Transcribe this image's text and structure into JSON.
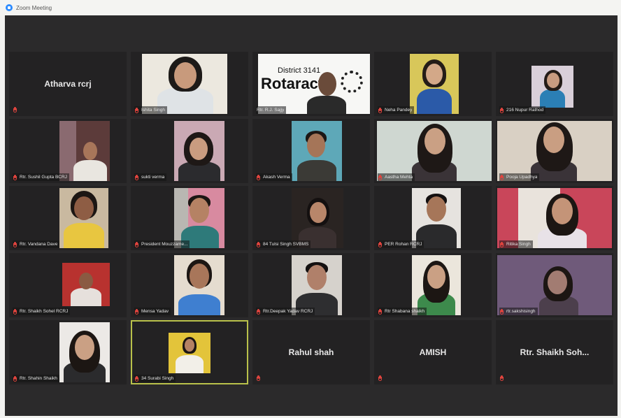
{
  "window": {
    "title": "Zoom Meeting"
  },
  "participants": [
    {
      "name": "Atharva rcrj",
      "video": false,
      "muted": true
    },
    {
      "name": "Ishita Singh",
      "video": true,
      "muted": true
    },
    {
      "name": "Rtr. R.J. Sajjy",
      "video": true,
      "muted": false,
      "overlay": {
        "line1": "District 3141",
        "line2": "Rotaract"
      }
    },
    {
      "name": "Neha Pandey",
      "video": true,
      "muted": true
    },
    {
      "name": "216 Nupur Rathod",
      "video": true,
      "muted": true
    },
    {
      "name": "Rtr. Sushil Gupta BCRJ",
      "video": true,
      "muted": true
    },
    {
      "name": "sukti verma",
      "video": true,
      "muted": true
    },
    {
      "name": "Akash Verma",
      "video": true,
      "muted": true
    },
    {
      "name": "Aastha Mehta",
      "video": true,
      "muted": true
    },
    {
      "name": "Pooja Upadhya",
      "video": true,
      "muted": true
    },
    {
      "name": "Rtr. Vandana Dave",
      "video": true,
      "muted": true
    },
    {
      "name": "President Mouzzame...",
      "video": true,
      "muted": true
    },
    {
      "name": "84 Tulsi Singh SVBMS",
      "video": true,
      "muted": true
    },
    {
      "name": "PER Rohan RCRJ",
      "video": true,
      "muted": true
    },
    {
      "name": "Ritika Singh",
      "video": true,
      "muted": true
    },
    {
      "name": "Rtr. Shaikh Sohel RCRJ",
      "video": true,
      "muted": true
    },
    {
      "name": "Mensa Yadav",
      "video": true,
      "muted": true
    },
    {
      "name": "Rtr.Deepak Yadav RCRJ",
      "video": true,
      "muted": true
    },
    {
      "name": "Rtr Shabana shaikh",
      "video": true,
      "muted": true
    },
    {
      "name": "rtr.sakshisingh",
      "video": true,
      "muted": true
    },
    {
      "name": "Rtr. Shahin Shaikh",
      "video": true,
      "muted": true
    },
    {
      "name": "34 Surabi Singh",
      "video": true,
      "muted": true,
      "active": true
    },
    {
      "name": "Rahul shah",
      "video": false,
      "muted": true
    },
    {
      "name": "AMISH",
      "video": false,
      "muted": true
    },
    {
      "name": "Rtr. Shaikh Soh...",
      "video": false,
      "muted": true
    }
  ],
  "colors": {
    "active_speaker_border": "#b9c14a",
    "muted_mic": "#e0443e",
    "tile_bg": "#232223"
  }
}
